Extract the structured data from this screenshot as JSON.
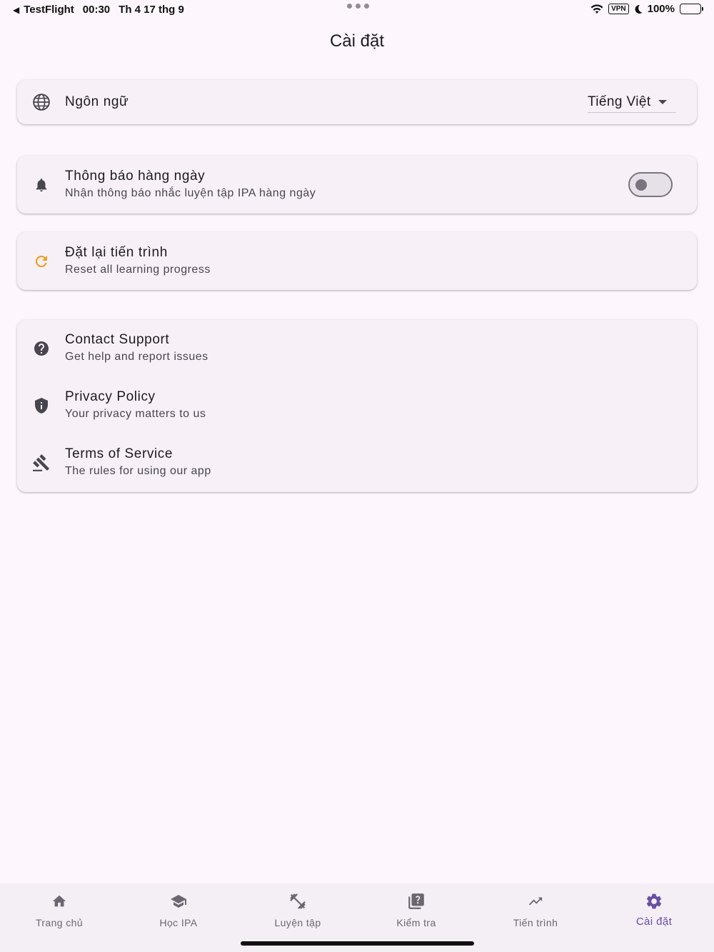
{
  "status_bar": {
    "back_app": "TestFlight",
    "time": "00:30",
    "date": "Th 4 17 thg 9",
    "vpn": "VPN",
    "battery": "100%"
  },
  "header": {
    "title": "Cài đặt"
  },
  "language": {
    "label": "Ngôn ngữ",
    "icon": "globe-icon",
    "selected": "Tiếng Việt"
  },
  "notifications": {
    "title": "Thông báo hàng ngày",
    "subtitle": "Nhận thông báo nhắc luyện tập IPA hàng ngày",
    "icon": "bell-icon",
    "enabled": false
  },
  "reset": {
    "title": "Đặt lại tiến trình",
    "subtitle": "Reset all learning progress",
    "icon": "refresh-icon",
    "icon_color": "#f29a17"
  },
  "info_items": [
    {
      "title": "Contact Support",
      "subtitle": "Get help and report issues",
      "icon": "help-circle-icon"
    },
    {
      "title": "Privacy Policy",
      "subtitle": "Your privacy matters to us",
      "icon": "shield-info-icon"
    },
    {
      "title": "Terms of Service",
      "subtitle": "The rules for using our app",
      "icon": "gavel-icon"
    }
  ],
  "bottom_nav": {
    "items": [
      {
        "label": "Trang chủ",
        "icon": "home-icon"
      },
      {
        "label": "Học IPA",
        "icon": "school-icon"
      },
      {
        "label": "Luyện tập",
        "icon": "fitness-icon"
      },
      {
        "label": "Kiểm tra",
        "icon": "quiz-icon"
      },
      {
        "label": "Tiến trình",
        "icon": "trending-up-icon"
      },
      {
        "label": "Cài đặt",
        "icon": "gear-icon"
      }
    ],
    "active_index": 5,
    "active_color": "#6750a4"
  }
}
